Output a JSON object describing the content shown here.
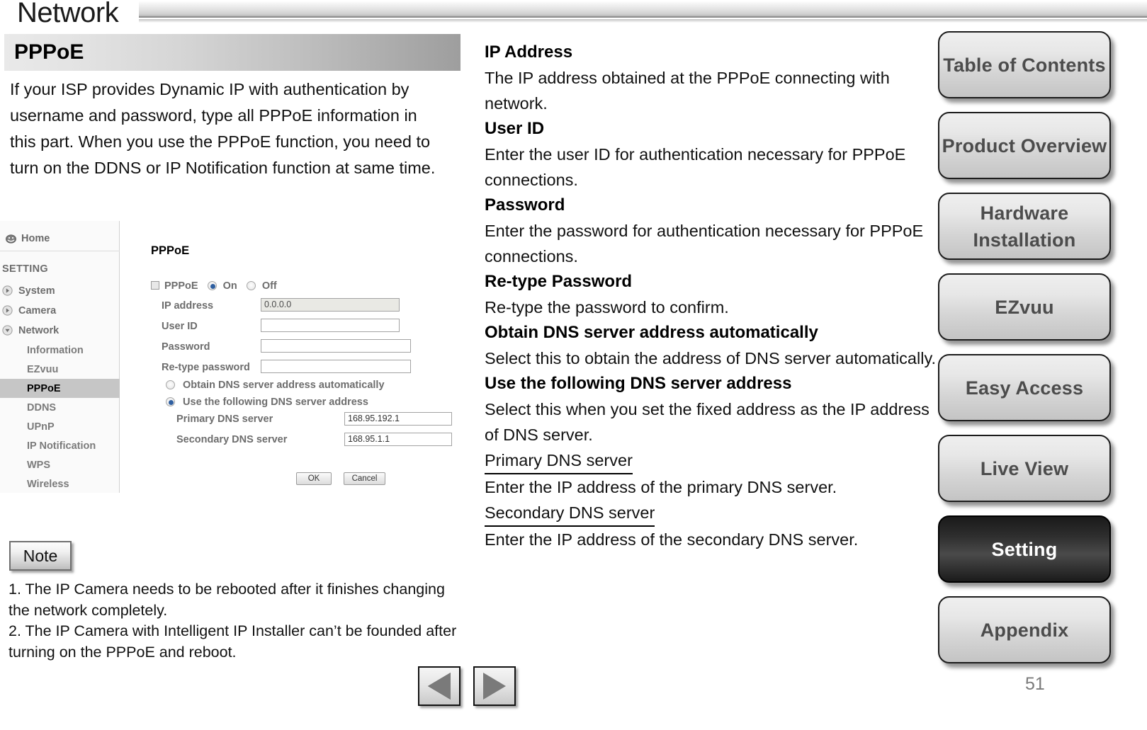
{
  "header": {
    "title": "Network"
  },
  "section": {
    "banner_label": "PPPoE",
    "intro": "If your ISP provides Dynamic IP with authentication by username and password, type all PPPoE information in this part. When you use the PPPoE function, you need to turn on the DDNS or IP Notification function at same time."
  },
  "webui": {
    "home_label": "Home",
    "setting_label": "SETTING",
    "groups": [
      {
        "label": "System",
        "expanded": false
      },
      {
        "label": "Camera",
        "expanded": false
      },
      {
        "label": "Network",
        "expanded": true
      }
    ],
    "network_items": [
      {
        "label": "Information",
        "selected": false
      },
      {
        "label": "EZvuu",
        "selected": false
      },
      {
        "label": "PPPoE",
        "selected": true
      },
      {
        "label": "DDNS",
        "selected": false
      },
      {
        "label": "UPnP",
        "selected": false
      },
      {
        "label": "IP Notification",
        "selected": false
      },
      {
        "label": "WPS",
        "selected": false
      },
      {
        "label": "Wireless",
        "selected": false
      }
    ],
    "form": {
      "title": "PPPoE",
      "toggle_label": "PPPoE",
      "on_label": "On",
      "off_label": "Off",
      "on_selected": true,
      "ip_address_label": "IP address",
      "ip_address_value": "0.0.0.0",
      "user_id_label": "User ID",
      "user_id_value": "",
      "password_label": "Password",
      "password_value": "",
      "retype_label": "Re-type password",
      "retype_value": "",
      "dns_auto_label": "Obtain DNS server address automatically",
      "dns_auto_selected": false,
      "dns_manual_label": "Use the following DNS server address",
      "dns_manual_selected": true,
      "primary_dns_label": "Primary DNS server",
      "primary_dns_value": "168.95.192.1",
      "secondary_dns_label": "Secondary DNS server",
      "secondary_dns_value": "168.95.1.1",
      "ok_label": "OK",
      "cancel_label": "Cancel"
    }
  },
  "note": {
    "button_label": "Note",
    "line1": "1. The IP Camera needs to be rebooted after it finishes changing the network completely.",
    "line2": "2. The IP Camera with Intelligent IP Installer can’t be founded after turning on the PPPoE and reboot."
  },
  "descriptions": [
    {
      "term": "IP Address",
      "text": "The IP address obtained at the PPPoE connecting with network.",
      "underline": false
    },
    {
      "term": "User ID",
      "text": "Enter the user ID for authentication necessary for PPPoE connections.",
      "underline": false
    },
    {
      "term": "Password",
      "text": "Enter the password for authentication necessary for PPPoE connections.",
      "underline": false
    },
    {
      "term": "Re-type Password",
      "text": "Re-type the password to confirm.",
      "underline": false
    },
    {
      "term": "Obtain DNS server address automatically",
      "text": "Select this to obtain the address of DNS server automatically.",
      "underline": false
    },
    {
      "term": "Use the following DNS server address",
      "text": "Select this when you set the fixed address as the IP address of DNS server.",
      "underline": false
    },
    {
      "term": "Primary DNS server",
      "text": "Enter the IP address of the primary DNS server.",
      "underline": true
    },
    {
      "term": "Secondary DNS server",
      "text": "Enter the IP address of the secondary DNS server.",
      "underline": true
    }
  ],
  "right_nav": {
    "items": [
      {
        "label": "Table of Contents",
        "active": false
      },
      {
        "label": "Product Overview",
        "active": false
      },
      {
        "label": "Hardware Installation",
        "active": false
      },
      {
        "label": "EZvuu",
        "active": false
      },
      {
        "label": "Easy Access",
        "active": false
      },
      {
        "label": "Live View",
        "active": false
      },
      {
        "label": "Setting",
        "active": true
      },
      {
        "label": "Appendix",
        "active": false
      }
    ]
  },
  "footer": {
    "prev_label": "Previous page",
    "next_label": "Next page",
    "page_number": "51"
  },
  "colors": {
    "active_nav_bg": "#1b1b1b",
    "selected_item_bg": "#c6c6c6",
    "radio_dot": "#2f5fa0"
  }
}
